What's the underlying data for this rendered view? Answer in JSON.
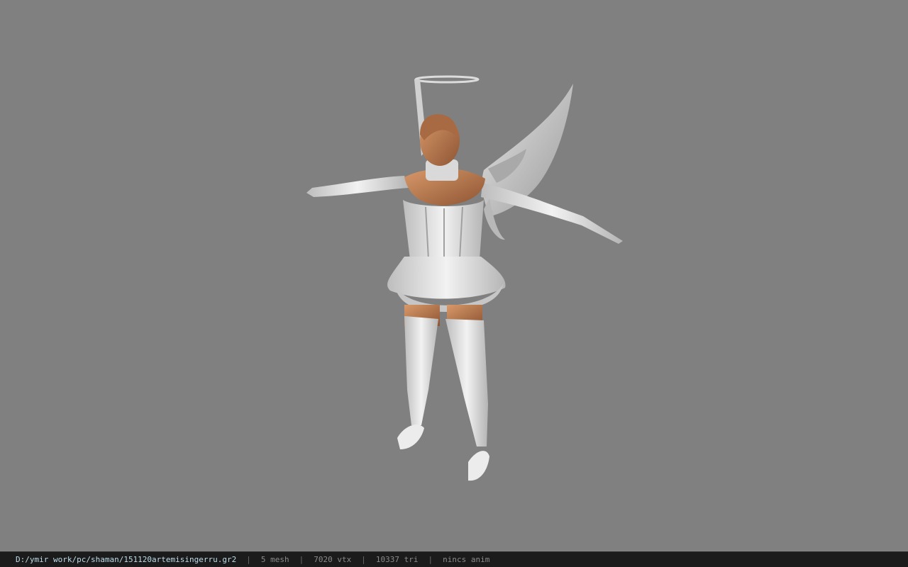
{
  "window": {
    "background_color": "#808080",
    "status_background_color": "#1b1b1b"
  },
  "viewport": {
    "model_icon": "character-model-icon"
  },
  "statusbar": {
    "file_path": "D:/ymir work/pc/shaman/151120artemisingerru.gr2",
    "separator": "|",
    "mesh_count": "5 mesh",
    "vertex_count": "7020 vtx",
    "triangle_count": "10337 tri",
    "animation": "nincs anim"
  }
}
